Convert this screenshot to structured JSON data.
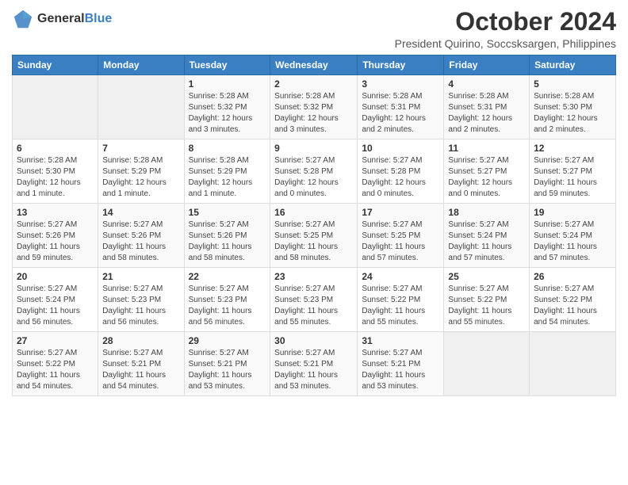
{
  "logo": {
    "text_general": "General",
    "text_blue": "Blue"
  },
  "header": {
    "month": "October 2024",
    "subtitle": "President Quirino, Soccsksargen, Philippines"
  },
  "weekdays": [
    "Sunday",
    "Monday",
    "Tuesday",
    "Wednesday",
    "Thursday",
    "Friday",
    "Saturday"
  ],
  "weeks": [
    [
      null,
      null,
      {
        "day": "1",
        "sunrise": "Sunrise: 5:28 AM",
        "sunset": "Sunset: 5:32 PM",
        "daylight": "Daylight: 12 hours and 3 minutes."
      },
      {
        "day": "2",
        "sunrise": "Sunrise: 5:28 AM",
        "sunset": "Sunset: 5:32 PM",
        "daylight": "Daylight: 12 hours and 3 minutes."
      },
      {
        "day": "3",
        "sunrise": "Sunrise: 5:28 AM",
        "sunset": "Sunset: 5:31 PM",
        "daylight": "Daylight: 12 hours and 2 minutes."
      },
      {
        "day": "4",
        "sunrise": "Sunrise: 5:28 AM",
        "sunset": "Sunset: 5:31 PM",
        "daylight": "Daylight: 12 hours and 2 minutes."
      },
      {
        "day": "5",
        "sunrise": "Sunrise: 5:28 AM",
        "sunset": "Sunset: 5:30 PM",
        "daylight": "Daylight: 12 hours and 2 minutes."
      }
    ],
    [
      {
        "day": "6",
        "sunrise": "Sunrise: 5:28 AM",
        "sunset": "Sunset: 5:30 PM",
        "daylight": "Daylight: 12 hours and 1 minute."
      },
      {
        "day": "7",
        "sunrise": "Sunrise: 5:28 AM",
        "sunset": "Sunset: 5:29 PM",
        "daylight": "Daylight: 12 hours and 1 minute."
      },
      {
        "day": "8",
        "sunrise": "Sunrise: 5:28 AM",
        "sunset": "Sunset: 5:29 PM",
        "daylight": "Daylight: 12 hours and 1 minute."
      },
      {
        "day": "9",
        "sunrise": "Sunrise: 5:27 AM",
        "sunset": "Sunset: 5:28 PM",
        "daylight": "Daylight: 12 hours and 0 minutes."
      },
      {
        "day": "10",
        "sunrise": "Sunrise: 5:27 AM",
        "sunset": "Sunset: 5:28 PM",
        "daylight": "Daylight: 12 hours and 0 minutes."
      },
      {
        "day": "11",
        "sunrise": "Sunrise: 5:27 AM",
        "sunset": "Sunset: 5:27 PM",
        "daylight": "Daylight: 12 hours and 0 minutes."
      },
      {
        "day": "12",
        "sunrise": "Sunrise: 5:27 AM",
        "sunset": "Sunset: 5:27 PM",
        "daylight": "Daylight: 11 hours and 59 minutes."
      }
    ],
    [
      {
        "day": "13",
        "sunrise": "Sunrise: 5:27 AM",
        "sunset": "Sunset: 5:26 PM",
        "daylight": "Daylight: 11 hours and 59 minutes."
      },
      {
        "day": "14",
        "sunrise": "Sunrise: 5:27 AM",
        "sunset": "Sunset: 5:26 PM",
        "daylight": "Daylight: 11 hours and 58 minutes."
      },
      {
        "day": "15",
        "sunrise": "Sunrise: 5:27 AM",
        "sunset": "Sunset: 5:26 PM",
        "daylight": "Daylight: 11 hours and 58 minutes."
      },
      {
        "day": "16",
        "sunrise": "Sunrise: 5:27 AM",
        "sunset": "Sunset: 5:25 PM",
        "daylight": "Daylight: 11 hours and 58 minutes."
      },
      {
        "day": "17",
        "sunrise": "Sunrise: 5:27 AM",
        "sunset": "Sunset: 5:25 PM",
        "daylight": "Daylight: 11 hours and 57 minutes."
      },
      {
        "day": "18",
        "sunrise": "Sunrise: 5:27 AM",
        "sunset": "Sunset: 5:24 PM",
        "daylight": "Daylight: 11 hours and 57 minutes."
      },
      {
        "day": "19",
        "sunrise": "Sunrise: 5:27 AM",
        "sunset": "Sunset: 5:24 PM",
        "daylight": "Daylight: 11 hours and 57 minutes."
      }
    ],
    [
      {
        "day": "20",
        "sunrise": "Sunrise: 5:27 AM",
        "sunset": "Sunset: 5:24 PM",
        "daylight": "Daylight: 11 hours and 56 minutes."
      },
      {
        "day": "21",
        "sunrise": "Sunrise: 5:27 AM",
        "sunset": "Sunset: 5:23 PM",
        "daylight": "Daylight: 11 hours and 56 minutes."
      },
      {
        "day": "22",
        "sunrise": "Sunrise: 5:27 AM",
        "sunset": "Sunset: 5:23 PM",
        "daylight": "Daylight: 11 hours and 56 minutes."
      },
      {
        "day": "23",
        "sunrise": "Sunrise: 5:27 AM",
        "sunset": "Sunset: 5:23 PM",
        "daylight": "Daylight: 11 hours and 55 minutes."
      },
      {
        "day": "24",
        "sunrise": "Sunrise: 5:27 AM",
        "sunset": "Sunset: 5:22 PM",
        "daylight": "Daylight: 11 hours and 55 minutes."
      },
      {
        "day": "25",
        "sunrise": "Sunrise: 5:27 AM",
        "sunset": "Sunset: 5:22 PM",
        "daylight": "Daylight: 11 hours and 55 minutes."
      },
      {
        "day": "26",
        "sunrise": "Sunrise: 5:27 AM",
        "sunset": "Sunset: 5:22 PM",
        "daylight": "Daylight: 11 hours and 54 minutes."
      }
    ],
    [
      {
        "day": "27",
        "sunrise": "Sunrise: 5:27 AM",
        "sunset": "Sunset: 5:22 PM",
        "daylight": "Daylight: 11 hours and 54 minutes."
      },
      {
        "day": "28",
        "sunrise": "Sunrise: 5:27 AM",
        "sunset": "Sunset: 5:21 PM",
        "daylight": "Daylight: 11 hours and 54 minutes."
      },
      {
        "day": "29",
        "sunrise": "Sunrise: 5:27 AM",
        "sunset": "Sunset: 5:21 PM",
        "daylight": "Daylight: 11 hours and 53 minutes."
      },
      {
        "day": "30",
        "sunrise": "Sunrise: 5:27 AM",
        "sunset": "Sunset: 5:21 PM",
        "daylight": "Daylight: 11 hours and 53 minutes."
      },
      {
        "day": "31",
        "sunrise": "Sunrise: 5:27 AM",
        "sunset": "Sunset: 5:21 PM",
        "daylight": "Daylight: 11 hours and 53 minutes."
      },
      null,
      null
    ]
  ]
}
